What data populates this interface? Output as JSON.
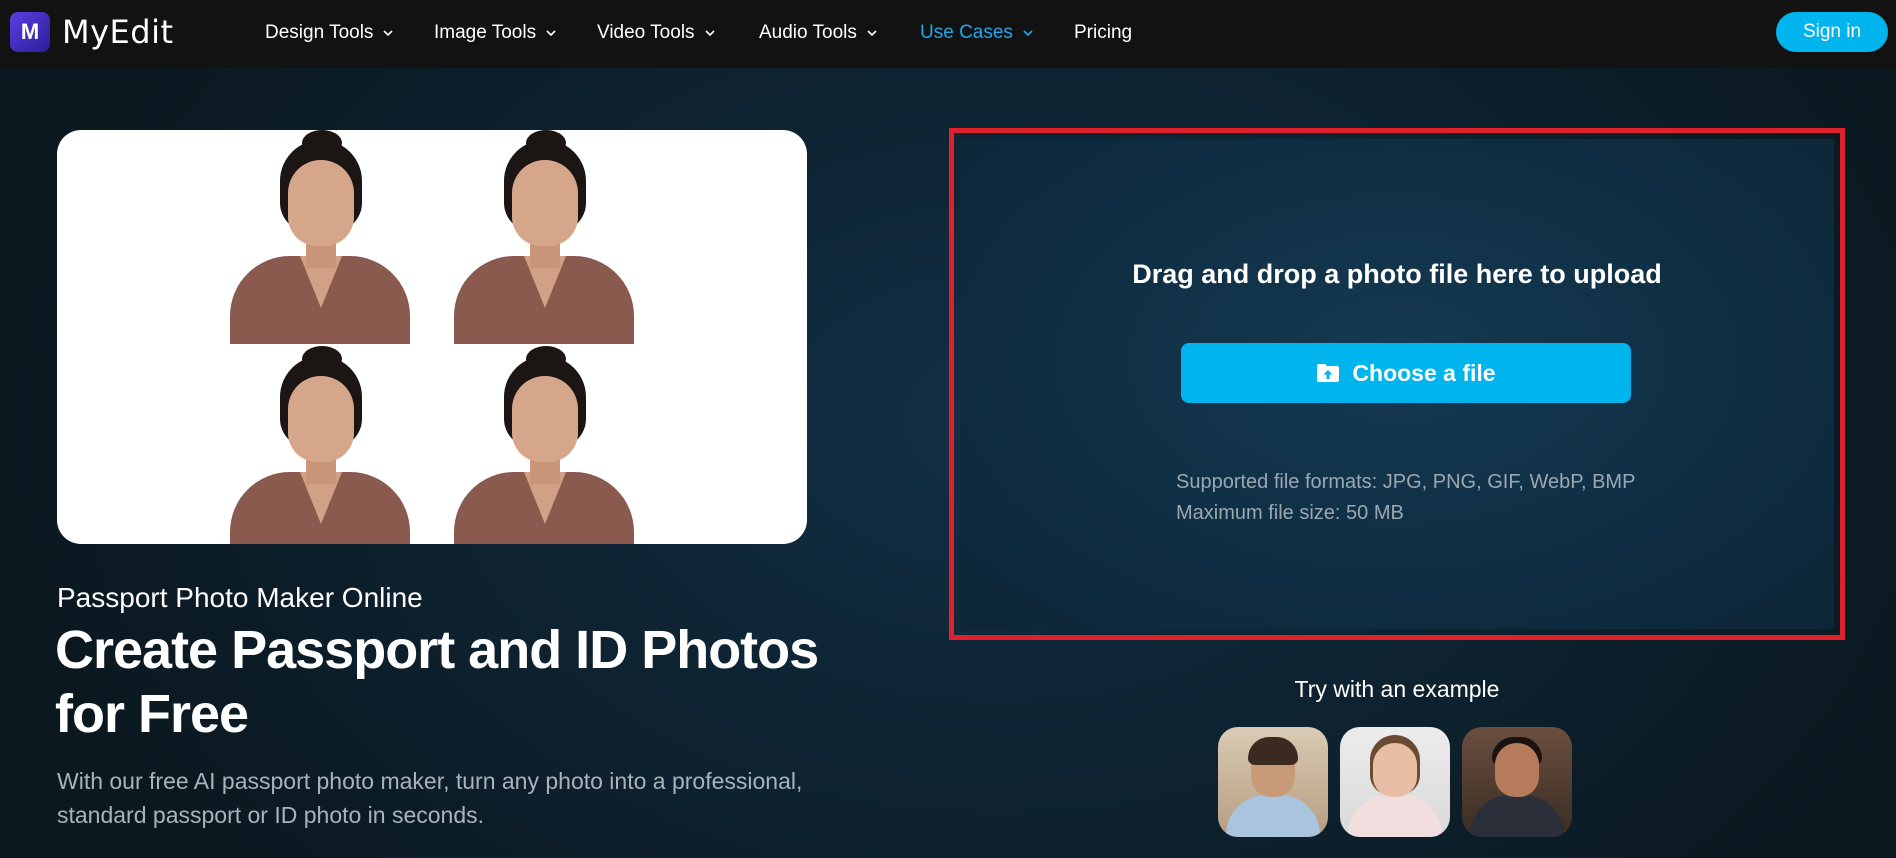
{
  "brand": {
    "name": "MyEdit",
    "logo_letter": "M"
  },
  "nav": {
    "items": [
      {
        "label": "Design Tools",
        "has_dropdown": true,
        "active": false
      },
      {
        "label": "Image Tools",
        "has_dropdown": true,
        "active": false
      },
      {
        "label": "Video Tools",
        "has_dropdown": true,
        "active": false
      },
      {
        "label": "Audio Tools",
        "has_dropdown": true,
        "active": false
      },
      {
        "label": "Use Cases",
        "has_dropdown": true,
        "active": true
      },
      {
        "label": "Pricing",
        "has_dropdown": false,
        "active": false
      }
    ],
    "signin_label": "Sign in"
  },
  "hero": {
    "subtitle": "Passport Photo Maker Online",
    "title": "Create Passport and ID Photos for Free",
    "description": "With our free AI passport photo maker, turn any photo into a professional, standard passport or ID photo in seconds."
  },
  "upload": {
    "drag_text": "Drag and drop a photo file here to upload",
    "choose_label": "Choose a file",
    "formats_text": "Supported file formats: JPG, PNG, GIF, WebP, BMP",
    "max_size_text": "Maximum file size: 50 MB"
  },
  "examples": {
    "label": "Try with an example",
    "items": [
      "example-man",
      "example-girl",
      "example-woman"
    ]
  },
  "colors": {
    "accent": "#00b4ee",
    "active_nav": "#1fa8ec",
    "highlight_border": "#e0202a",
    "nav_bg": "#121212"
  }
}
